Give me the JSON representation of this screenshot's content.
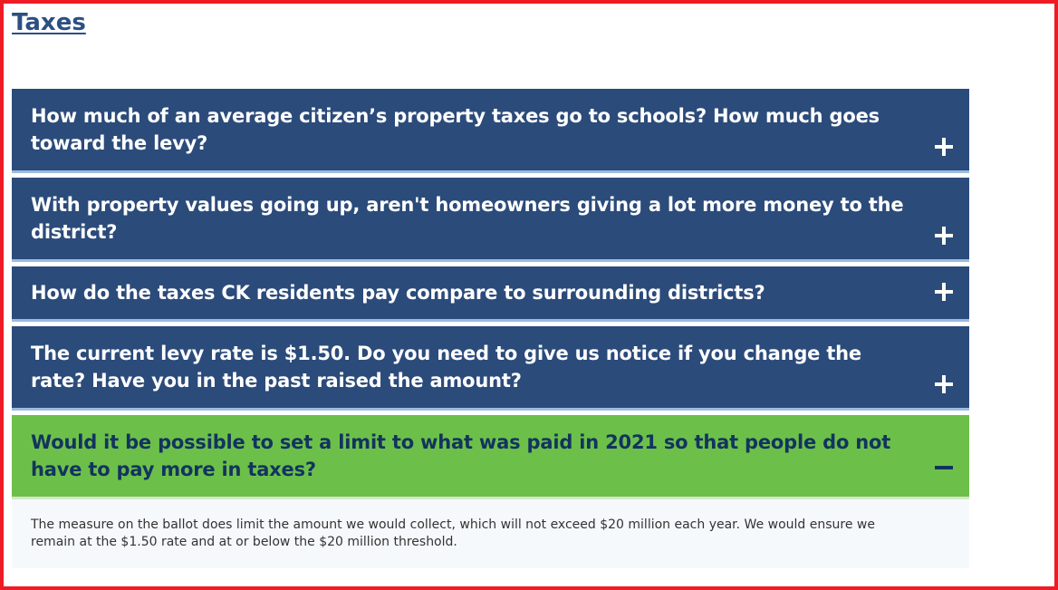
{
  "section": {
    "title": "Taxes"
  },
  "faq": {
    "items": [
      {
        "question": "How much of an average citizen’s property taxes go to schools? How much goes toward the levy?",
        "expanded": false
      },
      {
        "question": "With property values going up, aren't homeowners giving a lot more money to the district?",
        "expanded": false
      },
      {
        "question": "How do the taxes CK residents pay compare to surrounding districts?",
        "expanded": false
      },
      {
        "question": "The current levy rate is $1.50. Do you need to give us notice if you change the rate? Have you in the past raised the amount?",
        "expanded": false
      },
      {
        "question": "Would it be possible to set a limit to what was paid in 2021 so that people do not have to pay more in taxes?",
        "expanded": true,
        "answer": "The measure on the ballot does limit the amount we would collect, which will not exceed $20 million each year. We would ensure we remain at the $1.50 rate and at or below the $20 million threshold."
      }
    ]
  },
  "icons": {
    "expand": "plus-icon",
    "collapse": "minus-icon"
  },
  "colors": {
    "frame_border": "#ed1c24",
    "title": "#2b4f82",
    "header_collapsed": "#2b4b7a",
    "header_expanded": "#6cc04a",
    "header_expanded_text": "#13335f",
    "answer_background": "#f6f9fc"
  }
}
